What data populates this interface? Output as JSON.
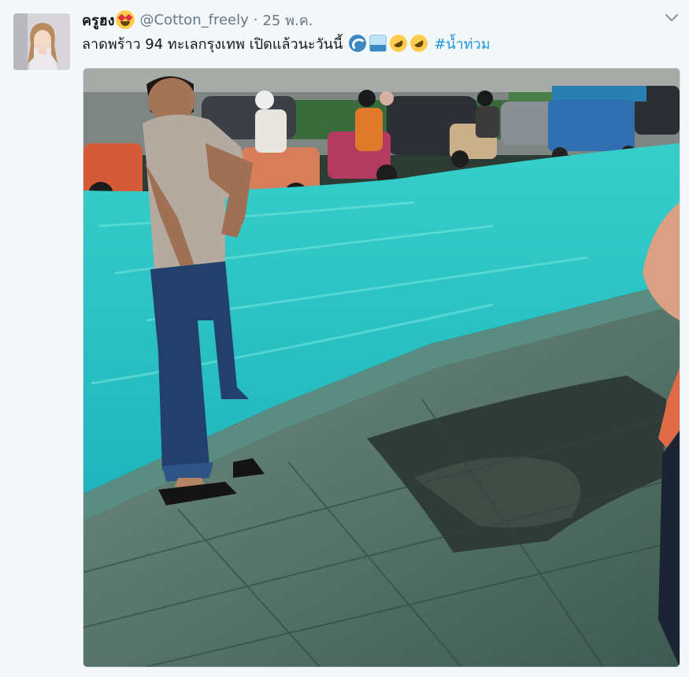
{
  "tweet": {
    "display_name": "ครูฮง",
    "handle": "@Cotton_freely",
    "separator": "·",
    "date": "25 พ.ค.",
    "text": "ลาดพร้าว 94 ทะเลกรุงเทพ เปิดแล้วนะวันนี้",
    "hashtag": "#น้ำท่วม",
    "emojis": [
      "water-wave-emoji",
      "flood-emoji",
      "rofl-emoji",
      "rofl-emoji"
    ],
    "name_emoji": "heart-eyes-emoji",
    "photo_alt": ""
  },
  "colors": {
    "background": "#f5f8fa",
    "text": "#14171a",
    "muted": "#657786",
    "link": "#1b95e0",
    "flood_water": "#28c4c3"
  }
}
